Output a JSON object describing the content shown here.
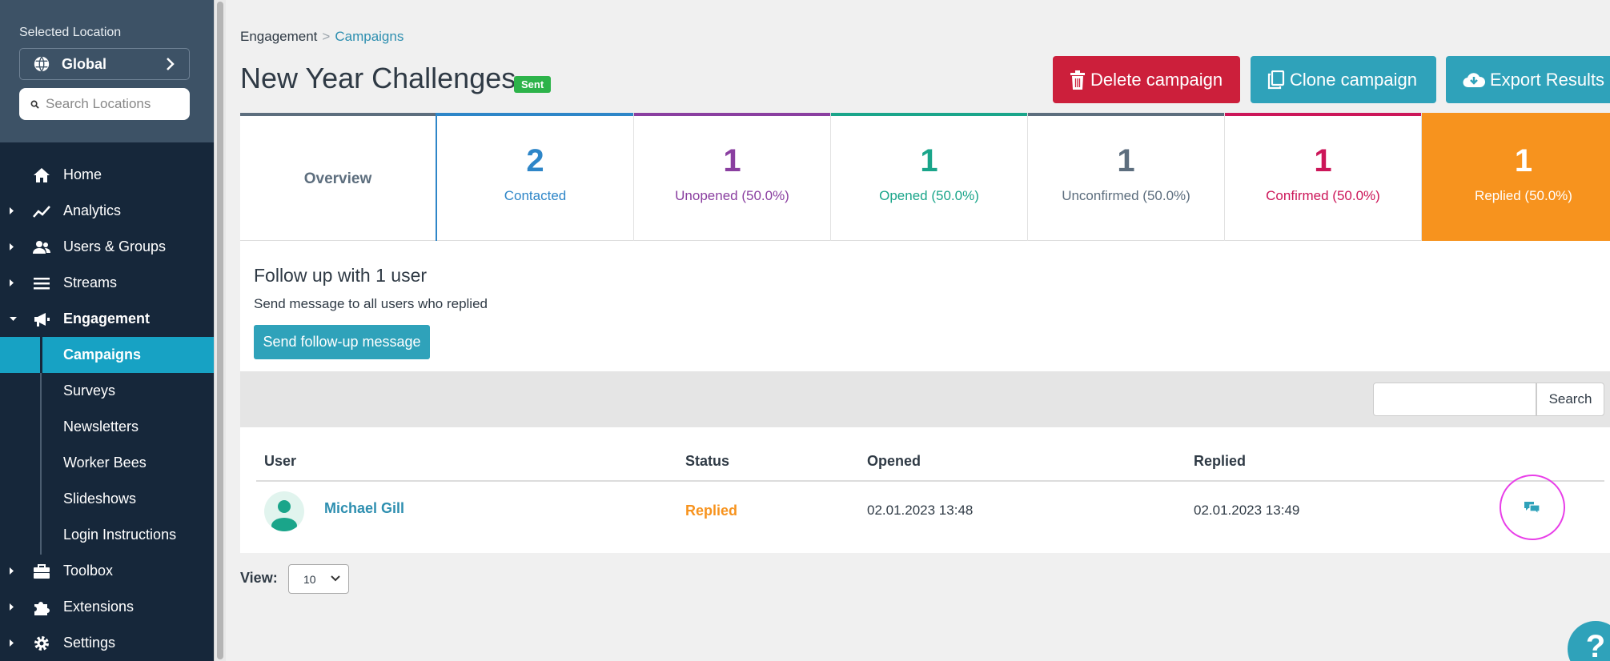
{
  "location": {
    "label": "Selected Location",
    "selected": "Global",
    "search_placeholder": "Search Locations"
  },
  "nav": {
    "items": [
      {
        "label": "Home",
        "icon": "home-icon"
      },
      {
        "label": "Analytics",
        "icon": "chart-line-icon"
      },
      {
        "label": "Users & Groups",
        "icon": "users-icon"
      },
      {
        "label": "Streams",
        "icon": "bars-icon"
      },
      {
        "label": "Engagement",
        "icon": "megaphone-icon"
      }
    ],
    "engagement_sub": [
      {
        "label": "Campaigns"
      },
      {
        "label": "Surveys"
      },
      {
        "label": "Newsletters"
      },
      {
        "label": "Worker Bees"
      },
      {
        "label": "Slideshows"
      },
      {
        "label": "Login Instructions"
      }
    ],
    "bottom": [
      {
        "label": "Toolbox",
        "icon": "toolbox-icon"
      },
      {
        "label": "Extensions",
        "icon": "puzzle-icon"
      },
      {
        "label": "Settings",
        "icon": "gear-icon"
      }
    ],
    "active": "Campaigns"
  },
  "breadcrumb": {
    "root": "Engagement",
    "sep": ">",
    "current": "Campaigns"
  },
  "page": {
    "title": "New Year Challenges",
    "badge": "Sent"
  },
  "actions": {
    "delete": "Delete campaign",
    "clone": "Clone campaign",
    "export": "Export Results"
  },
  "stats": {
    "overview": "Overview",
    "contacted": {
      "count": "2",
      "label": "Contacted",
      "color": "#2e86c8"
    },
    "unopened": {
      "count": "1",
      "label": "Unopened (50.0%)",
      "color": "#8a3fa0"
    },
    "opened": {
      "count": "1",
      "label": "Opened (50.0%)",
      "color": "#1aa58a"
    },
    "unconfirmed": {
      "count": "1",
      "label": "Unconfirmed (50.0%)",
      "color": "#5d6e7e"
    },
    "confirmed": {
      "count": "1",
      "label": "Confirmed (50.0%)",
      "color": "#cc1659"
    },
    "replied": {
      "count": "1",
      "label": "Replied (50.0%)",
      "color": "#f7931e"
    }
  },
  "followup": {
    "title": "Follow up with 1 user",
    "desc": "Send message to all users who replied",
    "button": "Send follow-up message"
  },
  "search": {
    "button": "Search",
    "value": ""
  },
  "table": {
    "headers": {
      "user": "User",
      "status": "Status",
      "opened": "Opened",
      "replied": "Replied"
    },
    "rows": [
      {
        "user": "Michael Gill",
        "status": "Replied",
        "opened": "02.01.2023 13:48",
        "replied": "02.01.2023 13:49"
      }
    ]
  },
  "view": {
    "label": "View:",
    "value": "10"
  },
  "help": "?"
}
